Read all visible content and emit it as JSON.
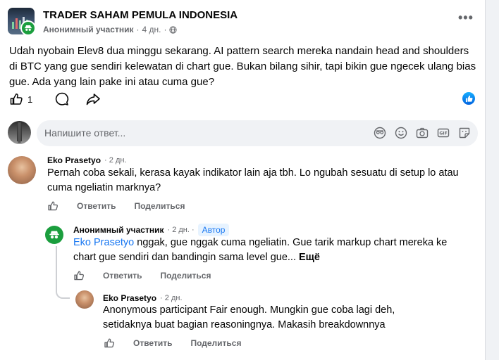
{
  "post": {
    "group_name": "TRADER SAHAM PEMULA INDONESIA",
    "author": "Анонимный участник",
    "time": "4 дн.",
    "separator": "·",
    "more_label": "•••",
    "body": "Udah nyobain Elev8 dua minggu sekarang. AI pattern search mereka nandain head and shoulders di BTC yang gue sendiri kelewatan di chart gue. Bukan bilang sihir, tapi bikin gue ngecek ulang bias gue. Ada yang lain pake ini atau cuma gue?",
    "like_count": "1",
    "icons": [
      "like-icon",
      "comment-icon",
      "share-icon",
      "globe-icon",
      "anonymous-icon"
    ]
  },
  "composer": {
    "placeholder": "Напишите ответ...",
    "icons": [
      "avatar-icon",
      "emoji-icon",
      "camera-icon",
      "gif-icon",
      "sticker-icon"
    ]
  },
  "comments": [
    {
      "author": "Eko Prasetyo",
      "time": "2 дн.",
      "text": "Pernah coba sekali, kerasa kayak indikator lain aja tbh. Lo ngubah sesuatu di setup lo atau cuma ngeliatin marknya?",
      "reply_label": "Ответить",
      "share_label": "Поделиться"
    },
    {
      "author": "Анонимный участник",
      "time": "2 дн.",
      "badge": "Автор",
      "mention": "Eko Prasetyo",
      "text": " nggak, gue nggak cuma ngeliatin. Gue tarik markup chart mereka ke chart gue sendiri dan bandingin sama level gue...",
      "more": " Ещё",
      "reply_label": "Ответить",
      "share_label": "Поделиться"
    },
    {
      "author": "Eko Prasetyo",
      "time": "2 дн.",
      "text": "Anonymous participant Fair enough. Mungkin gue coba lagi deh, setidaknya buat bagian reasoningnya. Makasih breakdownnya",
      "reply_label": "Ответить",
      "share_label": "Поделиться"
    }
  ],
  "colors": {
    "accent": "#1877f2",
    "anon_green": "#1b9e3e",
    "secondary_text": "#65676b",
    "background": "#f0f2f5"
  }
}
